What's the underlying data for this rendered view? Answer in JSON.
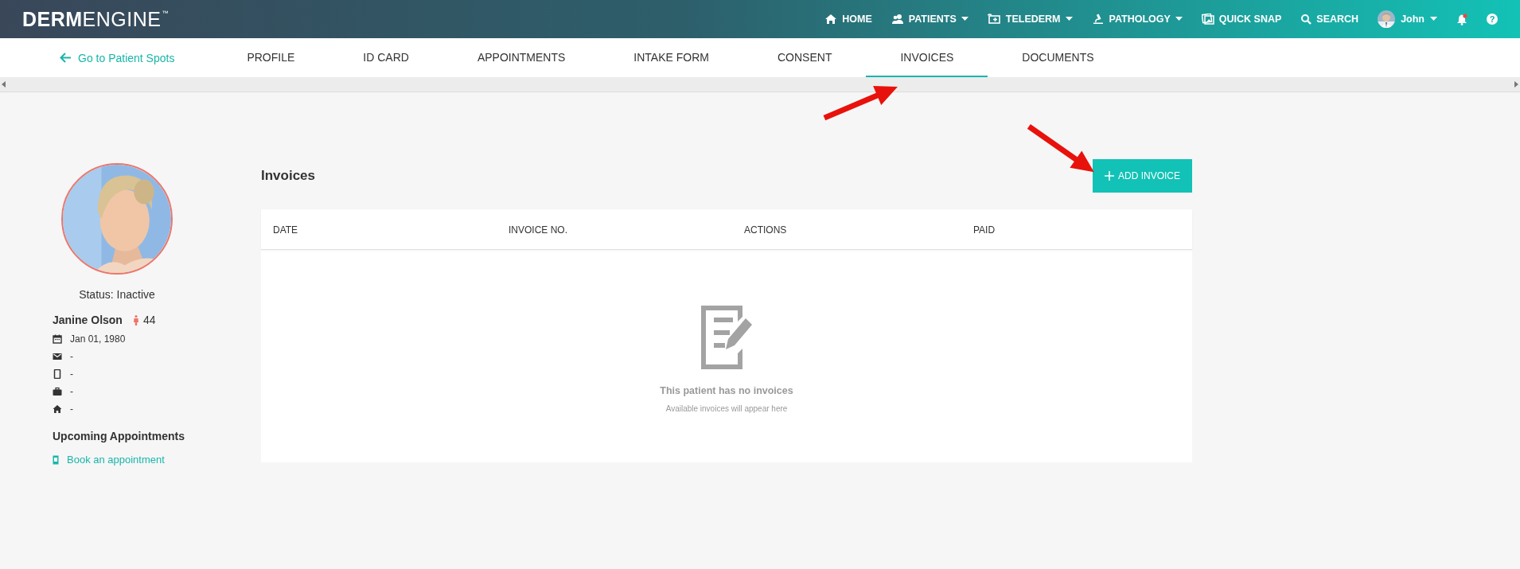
{
  "header": {
    "logo_bold": "DERM",
    "logo_light": "ENGINE",
    "logo_mark": "™",
    "nav": [
      {
        "label": "HOME",
        "dropdown": false
      },
      {
        "label": "PATIENTS",
        "dropdown": true
      },
      {
        "label": "TELEDERM",
        "dropdown": true
      },
      {
        "label": "PATHOLOGY",
        "dropdown": true
      },
      {
        "label": "QUICK SNAP",
        "dropdown": false
      },
      {
        "label": "SEARCH",
        "dropdown": false
      }
    ],
    "user": {
      "name": "John",
      "dropdown": true
    },
    "notifications": {
      "unread": true
    },
    "help": "?"
  },
  "tabs": {
    "back": "Go to Patient Spots",
    "items": [
      {
        "label": "PROFILE",
        "selected": false
      },
      {
        "label": "ID CARD",
        "selected": false
      },
      {
        "label": "APPOINTMENTS",
        "selected": false
      },
      {
        "label": "INTAKE FORM",
        "selected": false
      },
      {
        "label": "CONSENT",
        "selected": false
      },
      {
        "label": "INVOICES",
        "selected": true
      },
      {
        "label": "DOCUMENTS",
        "selected": false
      }
    ]
  },
  "patient": {
    "status": "Status: Inactive",
    "name": "Janine Olson",
    "age": "44",
    "details": [
      {
        "value": "Jan 01, 1980"
      },
      {
        "value": "-"
      },
      {
        "value": "-"
      },
      {
        "value": "-"
      },
      {
        "value": "-"
      }
    ],
    "appointments_heading": "Upcoming Appointments",
    "book_link": "Book an appointment"
  },
  "invoices": {
    "title": "Invoices",
    "add_button": "ADD INVOICE",
    "columns": [
      "DATE",
      "INVOICE NO.",
      "ACTIONS",
      "PAID"
    ],
    "empty_title": "This patient has no invoices",
    "empty_hint": "Available invoices will appear here"
  },
  "annotations": [
    {
      "kind": "arrow"
    },
    {
      "kind": "arrow"
    }
  ]
}
